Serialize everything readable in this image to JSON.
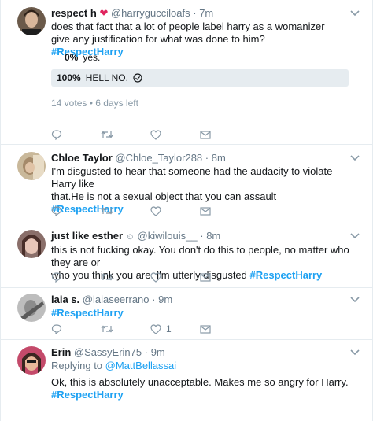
{
  "tweets": [
    {
      "name": "respect h",
      "handle": "@harrygucciloafs",
      "time": "7m",
      "text": "does that fact that a lot of people label harry as a womanizer give any justification for what was done to him?",
      "hashtag": "#RespectHarry",
      "poll": {
        "options": [
          {
            "pct": "0%",
            "label": "yes.",
            "fraction": 0.0
          },
          {
            "pct": "100%",
            "label": "HELL NO.",
            "fraction": 1.0,
            "selected": true
          }
        ],
        "meta": "14 votes • 6 days left"
      }
    },
    {
      "name": "Chloe Taylor",
      "handle": "@Chloe_Taylor288",
      "time": "8m",
      "text_line1": "I'm disgusted to hear that someone had the audacity to violate Harry like",
      "text_line2": "that.He is not a sexual object that you can assault",
      "hashtag": "#RespectHarry"
    },
    {
      "name": "just like esther",
      "handle": "@kiwilouis__",
      "time": "8m",
      "text_line1": "this is not fucking okay. You don't do this to people, no matter who they are or",
      "text_line2": "who you think you are. I'm utterly disgusted",
      "hashtag": "#RespectHarry"
    },
    {
      "name": "laia s.",
      "handle": "@laiaseerrano",
      "time": "9m",
      "hashtag": "#RespectHarry",
      "like_count": "1"
    },
    {
      "name": "Erin",
      "handle": "@SassyErin75",
      "time": "9m",
      "reply_prefix": "Replying to",
      "reply_to": "@MattBellassai",
      "text": "Ok, this is absolutely unacceptable. Makes me so angry for Harry.",
      "hashtag": "#RespectHarry"
    }
  ],
  "separator": "·"
}
